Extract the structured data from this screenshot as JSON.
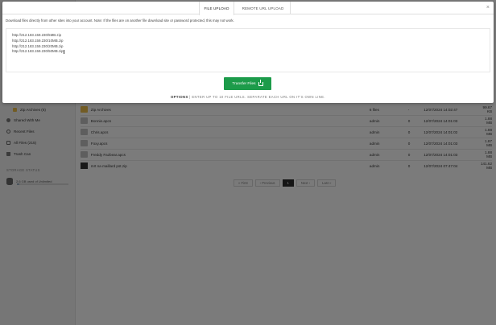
{
  "sidebar": {
    "items": [
      {
        "label": "Zip Archives (6)",
        "icon": "folder-icon"
      },
      {
        "label": "Shared With Me",
        "icon": "people-icon"
      },
      {
        "label": "Recent Files",
        "icon": "clock-icon"
      },
      {
        "label": "All Files (215)",
        "icon": "document-icon"
      },
      {
        "label": "Trash Can",
        "icon": "trash-icon"
      }
    ],
    "storage_heading": "STORAGE STATUS",
    "storage_text": "2.6 GB used of Unlimited",
    "storage_fraction": 0.05
  },
  "files": [
    {
      "name": "Zip Archives",
      "owner": "6 files",
      "count": "-",
      "date": "12/07/2024 14:02:47",
      "size": "99.67 KB",
      "icon": "zip-folder-icon"
    },
    {
      "name": "Bonnie.apcs",
      "owner": "admin",
      "count": "0",
      "date": "12/07/2024 14:01:03",
      "size": "1.88 MB",
      "icon": "doc-icon"
    },
    {
      "name": "Chris.apcs",
      "owner": "admin",
      "count": "0",
      "date": "12/07/2024 14:01:02",
      "size": "1.88 MB",
      "icon": "doc-icon"
    },
    {
      "name": "Foxy.apcs",
      "owner": "admin",
      "count": "0",
      "date": "12/07/2024 14:01:03",
      "size": "1.87 MB",
      "icon": "doc-icon"
    },
    {
      "name": "Freddy Fazbear.apcs",
      "owner": "admin",
      "count": "0",
      "date": "12/07/2024 14:01:03",
      "size": "1.88 MB",
      "icon": "doc-icon"
    },
    {
      "name": "mrt na maillard pst.zip",
      "owner": "admin",
      "count": "0",
      "date": "12/07/2024 07:47:04",
      "size": "141.62 MB",
      "icon": "archive-icon"
    }
  ],
  "pager": {
    "first": "« First",
    "previous": "‹ Previous",
    "current": "1",
    "next": "Next ›",
    "last": "Last »"
  },
  "modal": {
    "tab_file_upload": "FILE UPLOAD",
    "tab_remote_upload": "REMOTE URL UPLOAD",
    "close": "×",
    "notice": "Download files directly from other sites into your account. Note: If the files are on another file download site or password protected, this may not work.",
    "urls": [
      "http://212.183.159.230/5MB.zip",
      "http://212.183.159.230/10MB.zip",
      "http://212.183.159.230/20MB.zip",
      "http://212.183.159.230/50MB.zip"
    ],
    "transfer_label": "Transfer Files",
    "options_label": "OPTIONS",
    "options_separator": "|",
    "options_hint": "ENTER UP TO 10 FILE URLS. SEPARATE EACH URL ON IT'S OWN LINE."
  },
  "colors": {
    "accent_green": "#1c9b4a",
    "folder_yellow": "#e5b94a"
  }
}
